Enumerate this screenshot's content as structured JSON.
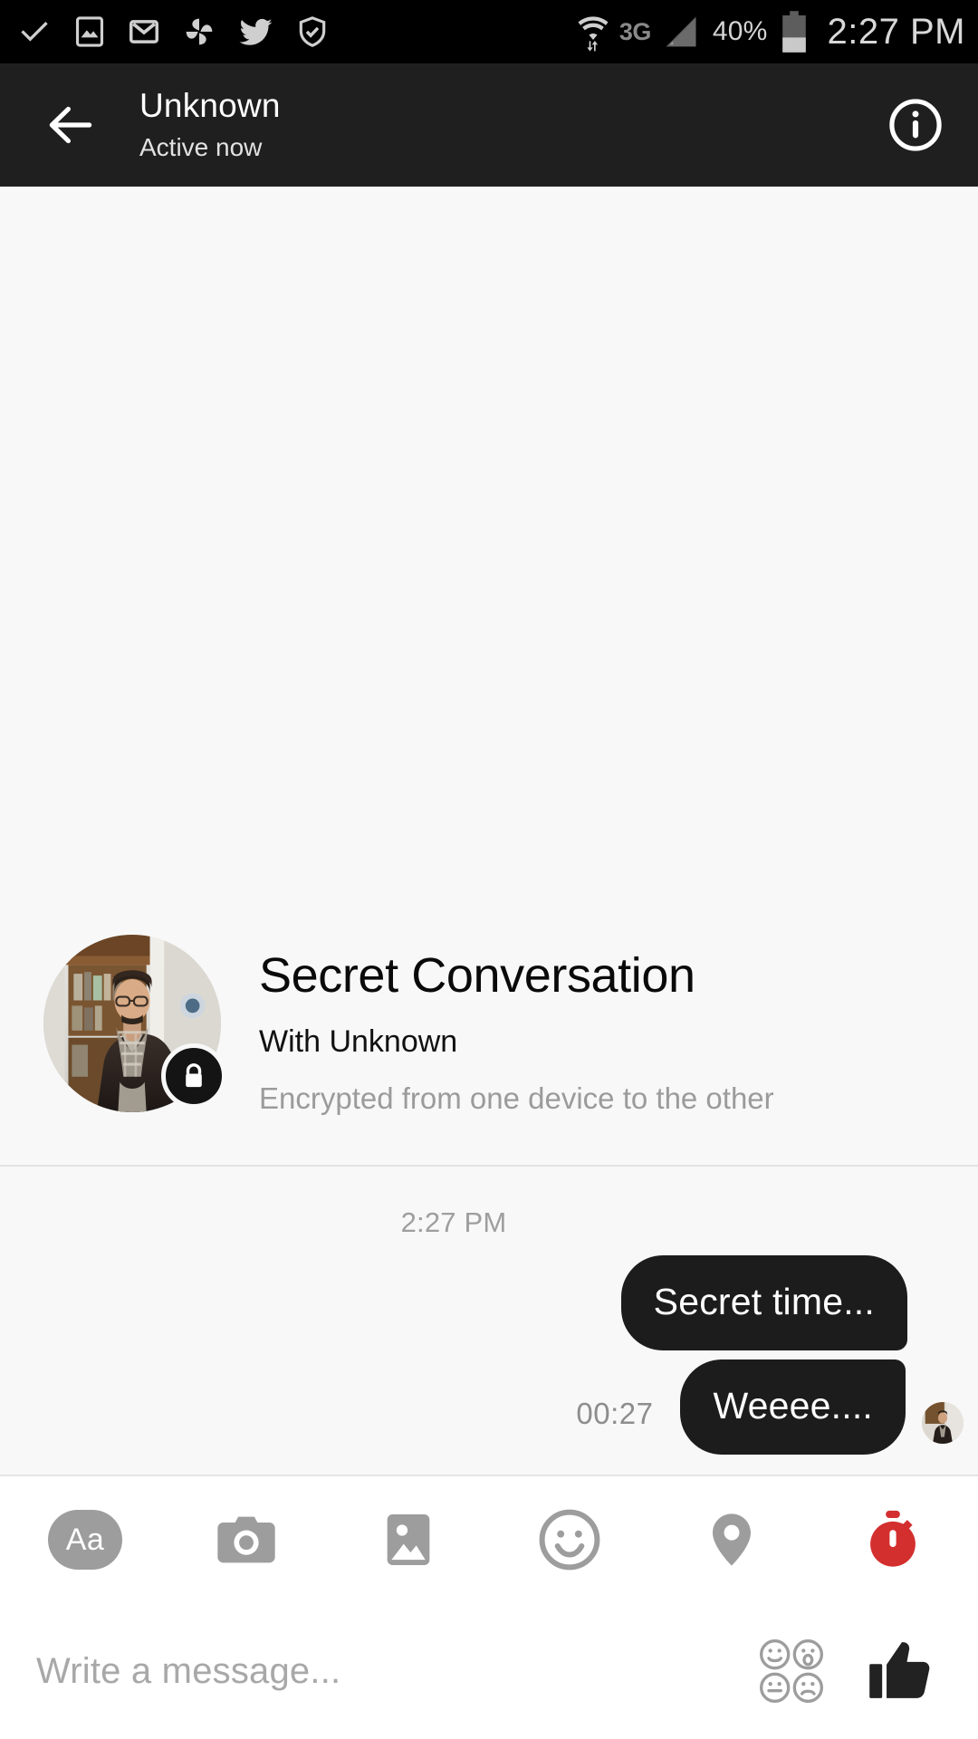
{
  "status_bar": {
    "time": "2:27 PM",
    "battery_percent": "40%",
    "network": "3G",
    "left_icons": [
      "check-icon",
      "screenshot-icon",
      "gmail-icon",
      "photos-pinwheel-icon",
      "twitter-icon",
      "shield-check-icon"
    ],
    "right_icons": [
      "wifi-icon",
      "network-3g-label",
      "signal-icon",
      "battery-percent-label",
      "battery-icon",
      "clock-label"
    ]
  },
  "header": {
    "title": "Unknown",
    "subtitle": "Active now",
    "back_icon": "back-arrow-icon",
    "info_icon": "info-icon"
  },
  "intro": {
    "title": "Secret Conversation",
    "with": "With Unknown",
    "description": "Encrypted from one device to the other",
    "lock_icon": "lock-icon",
    "avatar": "contact-avatar"
  },
  "messages": {
    "timestamp": "2:27 PM",
    "items": [
      {
        "text": "Secret time...",
        "side": "outgoing",
        "countdown": "",
        "has_avatar": false
      },
      {
        "text": "Weeee....",
        "side": "outgoing",
        "countdown": "00:27",
        "has_avatar": true
      }
    ]
  },
  "toolbar": {
    "items": [
      {
        "name": "text-format-button",
        "label": "Aa",
        "icon": "aa-icon",
        "color": "#9d9d9d"
      },
      {
        "name": "camera-button",
        "label": "",
        "icon": "camera-icon",
        "color": "#9d9d9d"
      },
      {
        "name": "gallery-button",
        "label": "",
        "icon": "image-icon",
        "color": "#9d9d9d"
      },
      {
        "name": "emoji-button",
        "label": "",
        "icon": "smiley-icon",
        "color": "#9d9d9d"
      },
      {
        "name": "location-button",
        "label": "",
        "icon": "location-pin-icon",
        "color": "#9d9d9d"
      },
      {
        "name": "disappearing-timer-button",
        "label": "",
        "icon": "stopwatch-icon",
        "color": "#d32f2f"
      }
    ]
  },
  "composer": {
    "placeholder": "Write a message...",
    "value": "",
    "sticker_icon": "sticker-grid-icon",
    "like_icon": "thumbs-up-icon"
  },
  "colors": {
    "status_bar_bg": "#000000",
    "header_bg": "#1f1f1f",
    "thread_bg": "#f8f8f8",
    "bubble_bg": "#1c1c1c",
    "bubble_text": "#ffffff",
    "muted_text": "#9b9b9b",
    "accent_timer": "#d32f2f",
    "composer_bg": "#ffffff"
  }
}
